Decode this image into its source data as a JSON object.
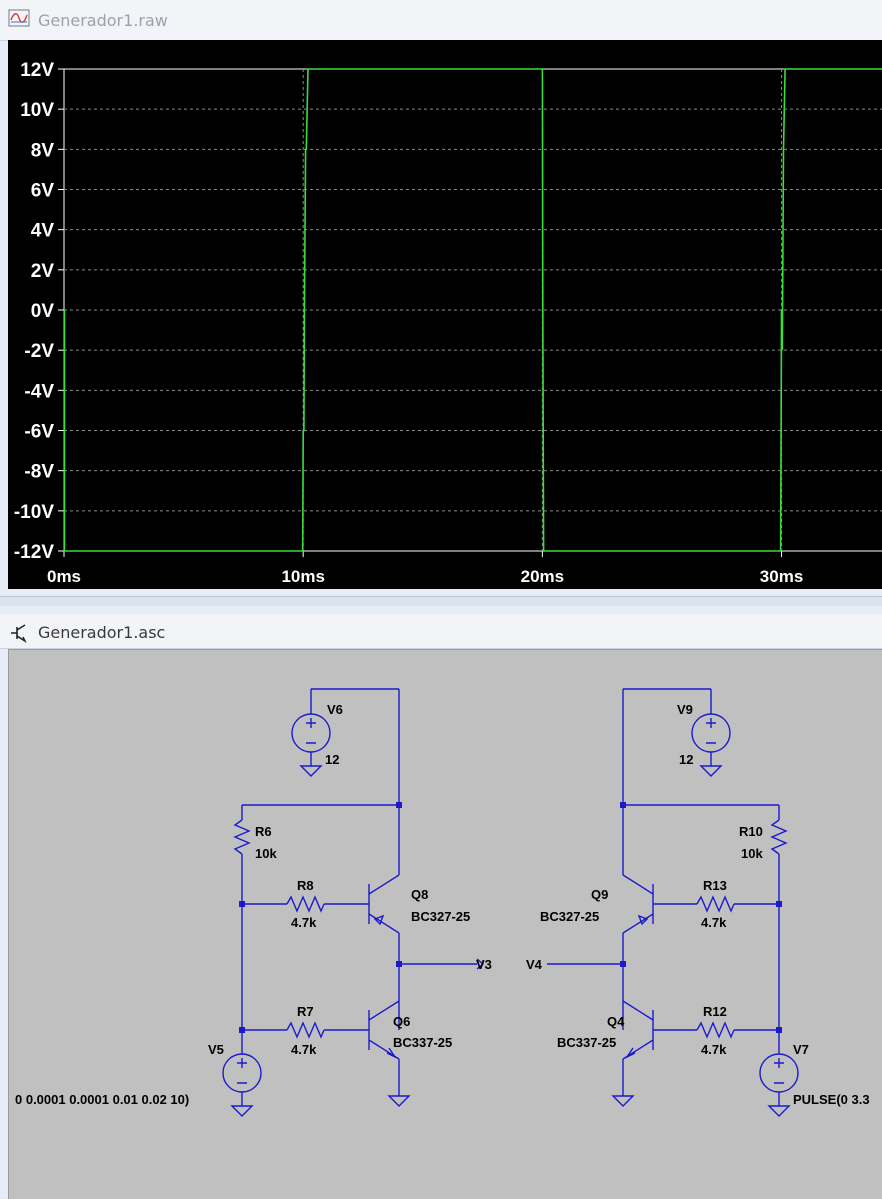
{
  "plot_window": {
    "title": "Generador1.raw",
    "icon": "waveform-icon"
  },
  "chart_data": {
    "type": "line",
    "xlabel": "",
    "ylabel": "",
    "x_ticks": [
      "0ms",
      "10ms",
      "20ms",
      "30ms"
    ],
    "y_ticks": [
      "12V",
      "10V",
      "8V",
      "6V",
      "4V",
      "2V",
      "0V",
      "-2V",
      "-4V",
      "-6V",
      "-8V",
      "-10V",
      "-12V"
    ],
    "xlim": [
      0,
      34.2
    ],
    "ylim": [
      -12,
      12
    ],
    "grid": true,
    "background": "#000000",
    "series": [
      {
        "color": "#3cdc3c",
        "x": [
          0,
          0.02,
          0.02,
          9.98,
          10.0,
          10.03,
          10.05,
          10.1,
          10.13,
          10.2,
          19.98,
          20.0,
          20.02,
          20.05,
          20.1,
          29.96,
          29.98,
          30.0,
          30.03,
          30.08,
          30.15,
          34.2
        ],
        "y": [
          0,
          0,
          -12,
          -12,
          -6,
          -6,
          0,
          8,
          8,
          12,
          12,
          12,
          0,
          -12,
          -12,
          -12,
          -6,
          0,
          -2,
          8,
          12,
          12
        ]
      }
    ]
  },
  "schematic_window": {
    "title": "Generador1.asc",
    "icon": "transistor-icon"
  },
  "schematic": {
    "V6": {
      "name": "V6",
      "value": "12"
    },
    "V9": {
      "name": "V9",
      "value": "12"
    },
    "R6": {
      "name": "R6",
      "value": "10k"
    },
    "R10": {
      "name": "R10",
      "value": "10k"
    },
    "R8": {
      "name": "R8",
      "value": "4.7k"
    },
    "R7": {
      "name": "R7",
      "value": "4.7k"
    },
    "R13": {
      "name": "R13",
      "value": "4.7k"
    },
    "R12": {
      "name": "R12",
      "value": "4.7k"
    },
    "Q8": {
      "name": "Q8",
      "model": "BC327-25"
    },
    "Q6": {
      "name": "Q6",
      "model": "BC337-25"
    },
    "Q9": {
      "name": "Q9",
      "model": "BC327-25"
    },
    "Q4": {
      "name": "Q4",
      "model": "BC337-25"
    },
    "V5": {
      "name": "V5",
      "value": "0 0.0001 0.0001 0.01 0.02 10)"
    },
    "V7": {
      "name": "V7",
      "value": "PULSE(0 3.3"
    },
    "net_V3": "V3",
    "net_V4": "V4"
  }
}
